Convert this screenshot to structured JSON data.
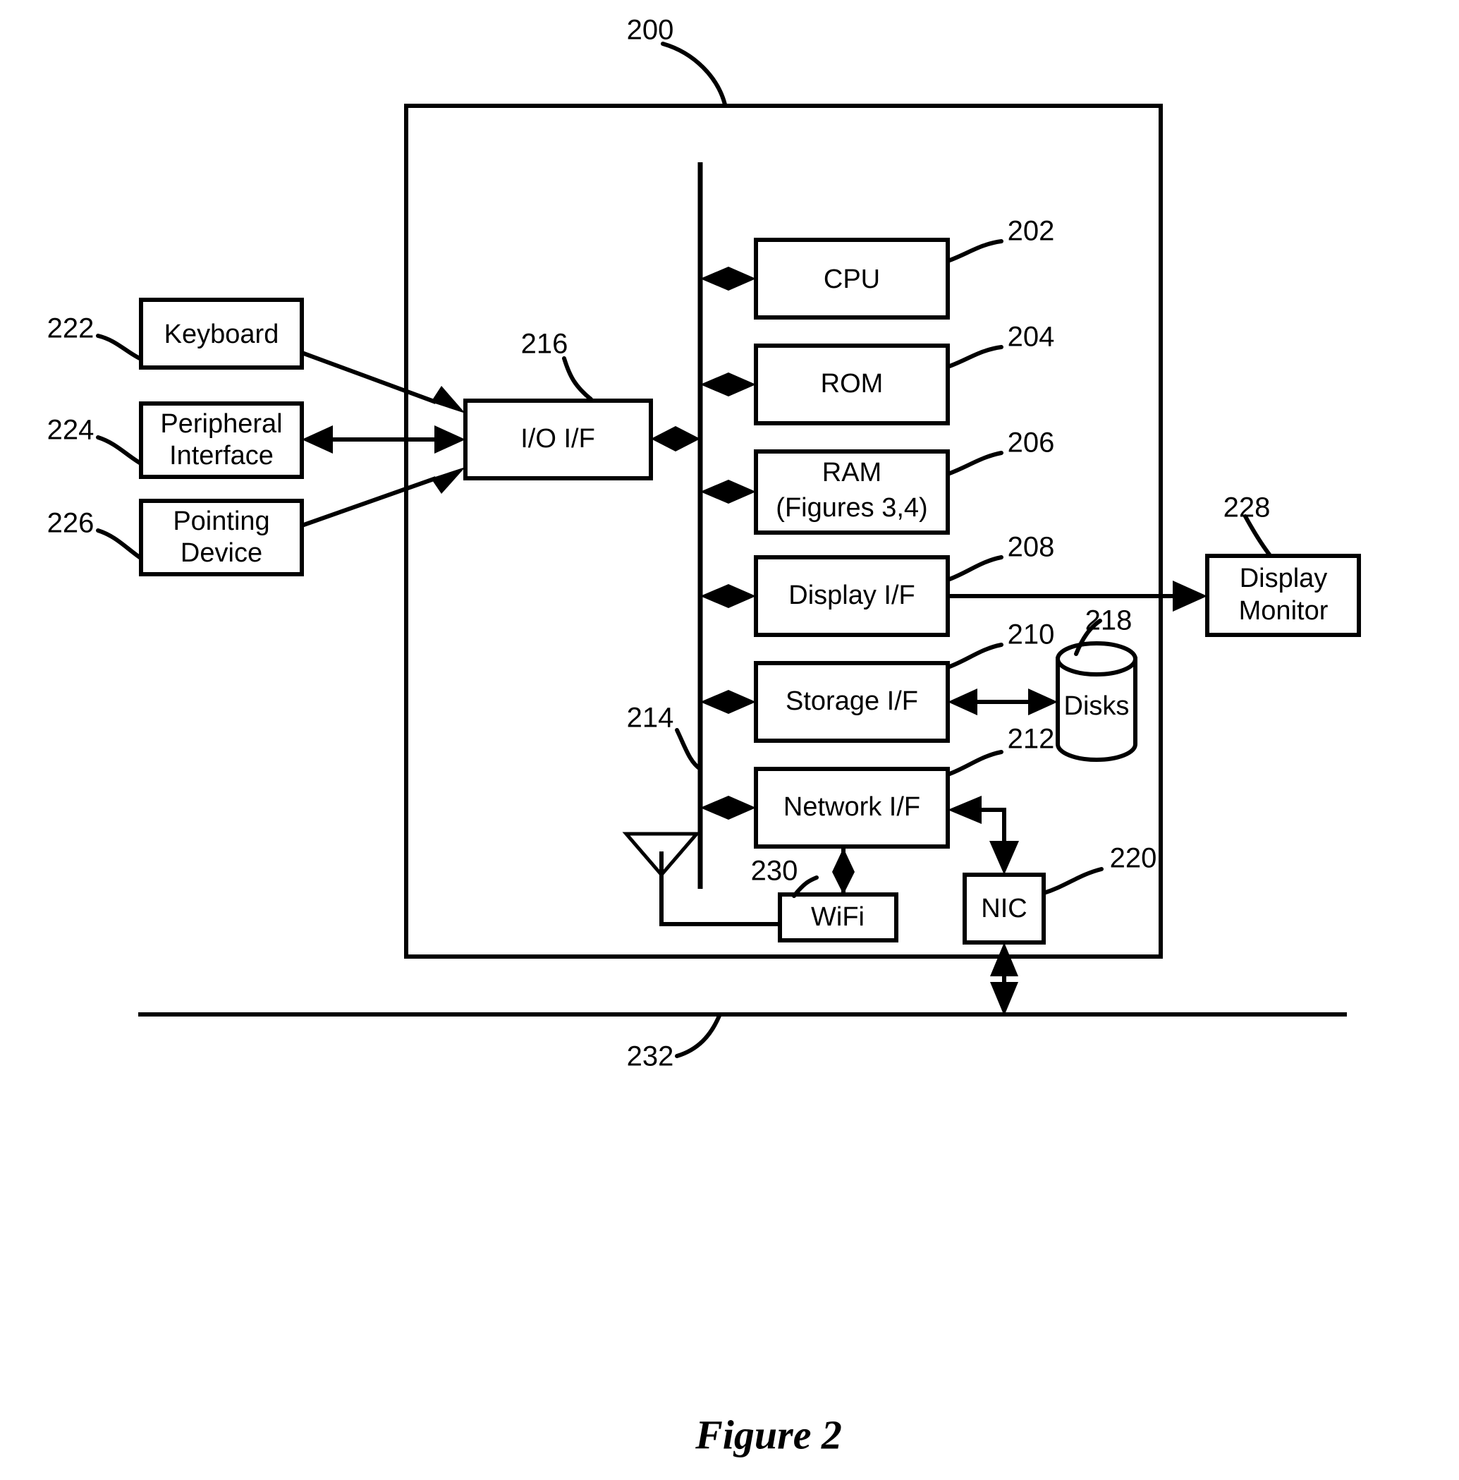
{
  "figure": {
    "caption": "Figure 2",
    "system_ref": "200",
    "bus_ref": "214",
    "network_ref": "232"
  },
  "enclosure": {
    "name": "computer-system-enclosure",
    "ref": "200"
  },
  "components": [
    {
      "id": "cpu",
      "label": "CPU",
      "ref": "202"
    },
    {
      "id": "rom",
      "label": "ROM",
      "ref": "204"
    },
    {
      "id": "ram",
      "label": "RAM",
      "label2": "(Figures 3,4)",
      "ref": "206"
    },
    {
      "id": "display-if",
      "label": "Display I/F",
      "ref": "208"
    },
    {
      "id": "storage-if",
      "label": "Storage I/F",
      "ref": "210"
    },
    {
      "id": "network-if",
      "label": "Network I/F",
      "ref": "212"
    }
  ],
  "io_interface": {
    "label": "I/O I/F",
    "ref": "216"
  },
  "input_devices": [
    {
      "id": "keyboard",
      "label": "Keyboard",
      "ref": "222"
    },
    {
      "id": "peripheral-interface",
      "label": "Peripheral",
      "label2": "Interface",
      "ref": "224"
    },
    {
      "id": "pointing-device",
      "label": "Pointing",
      "label2": "Device",
      "ref": "226"
    }
  ],
  "peripherals": [
    {
      "id": "display-monitor",
      "label": "Display",
      "label2": "Monitor",
      "ref": "228"
    },
    {
      "id": "disks",
      "label": "Disks",
      "ref": "218"
    },
    {
      "id": "wifi",
      "label": "WiFi",
      "ref": "230"
    },
    {
      "id": "nic",
      "label": "NIC",
      "ref": "220"
    }
  ],
  "bus": {
    "label_ref": "214"
  },
  "network": {
    "label_ref": "232"
  },
  "colors": {
    "stroke": "#000000",
    "background": "#ffffff"
  }
}
